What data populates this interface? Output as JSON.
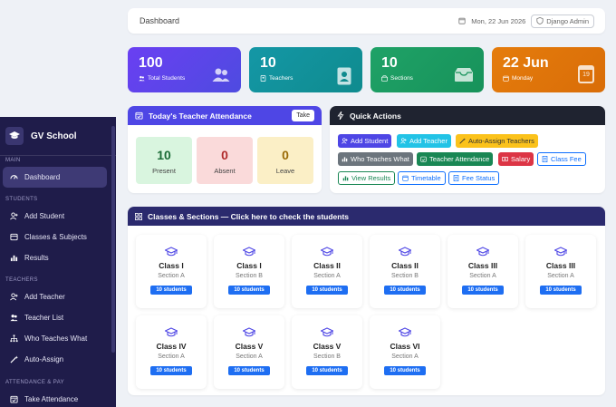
{
  "colors": {
    "sidebar_bg": "#1f1c4a",
    "card_students": "#5b3ff0",
    "card_teachers": "#12979c",
    "card_sections": "#1c9a5e",
    "card_date": "#e0780c",
    "attendance_header": "#4e46e5",
    "quick_actions_header": "#1f2330",
    "classes_header": "#2b2a6e",
    "badge_blue": "#1e6ef2"
  },
  "sidebar": {
    "brand": "GV School",
    "sections": [
      {
        "label": "MAIN"
      },
      {
        "label": "STUDENTS"
      },
      {
        "label": "TEACHERS"
      },
      {
        "label": "ATTENDANCE & PAY"
      }
    ],
    "items": [
      {
        "label": "Dashboard",
        "icon": "speedometer-icon",
        "active": true
      },
      {
        "label": "Add Student",
        "icon": "person-plus-icon"
      },
      {
        "label": "Classes & Subjects",
        "icon": "book-icon"
      },
      {
        "label": "Results",
        "icon": "bar-chart-icon"
      },
      {
        "label": "Add Teacher",
        "icon": "person-plus-icon"
      },
      {
        "label": "Teacher List",
        "icon": "people-icon"
      },
      {
        "label": "Who Teaches What",
        "icon": "network-icon"
      },
      {
        "label": "Auto-Assign",
        "icon": "magic-wand-icon"
      },
      {
        "label": "Take Attendance",
        "icon": "calendar-check-icon"
      }
    ]
  },
  "header": {
    "title": "Dashboard",
    "date": "Mon, 22 Jun 2026",
    "admin": "Django Admin"
  },
  "stats": [
    {
      "value": "100",
      "label": "Total Students",
      "icon": "people-icon"
    },
    {
      "value": "10",
      "label": "Teachers",
      "icon": "id-badge-icon"
    },
    {
      "value": "10",
      "label": "Sections",
      "icon": "inbox-icon"
    },
    {
      "value": "22 Jun",
      "label": "Monday",
      "icon": "calendar-icon",
      "icon_text": "19"
    }
  ],
  "attendance": {
    "title": "Today's Teacher Attendance",
    "take_label": "Take",
    "boxes": [
      {
        "value": "10",
        "label": "Present"
      },
      {
        "value": "0",
        "label": "Absent"
      },
      {
        "value": "0",
        "label": "Leave"
      }
    ]
  },
  "quick_actions": {
    "title": "Quick Actions",
    "buttons": [
      {
        "label": "Add Student",
        "icon": "person-plus-icon"
      },
      {
        "label": "Add Teacher",
        "icon": "person-plus-icon"
      },
      {
        "label": "Auto-Assign Teachers",
        "icon": "magic-wand-icon"
      },
      {
        "label": "Who Teaches What",
        "icon": "network-icon"
      },
      {
        "label": "Teacher Attendance",
        "icon": "calendar-check-icon"
      },
      {
        "label": "Salary",
        "icon": "cash-icon"
      },
      {
        "label": "Class Fee",
        "icon": "receipt-icon"
      },
      {
        "label": "View Results",
        "icon": "bar-chart-icon"
      },
      {
        "label": "Timetable",
        "icon": "calendar-icon"
      },
      {
        "label": "Fee Status",
        "icon": "receipt-icon"
      }
    ]
  },
  "classes": {
    "title": "Classes & Sections — Click here to check the students",
    "cards": [
      {
        "name": "Class I",
        "section": "Section A",
        "count": "10 students"
      },
      {
        "name": "Class I",
        "section": "Section B",
        "count": "10 students"
      },
      {
        "name": "Class II",
        "section": "Section A",
        "count": "10 students"
      },
      {
        "name": "Class II",
        "section": "Section B",
        "count": "10 students"
      },
      {
        "name": "Class III",
        "section": "Section A",
        "count": "10 students"
      },
      {
        "name": "Class III",
        "section": "Section A",
        "count": "10 students"
      },
      {
        "name": "Class IV",
        "section": "Section A",
        "count": "10 students"
      },
      {
        "name": "Class V",
        "section": "Section A",
        "count": "10 students"
      },
      {
        "name": "Class V",
        "section": "Section B",
        "count": "10 students"
      },
      {
        "name": "Class VI",
        "section": "Section A",
        "count": "10 students"
      }
    ]
  }
}
